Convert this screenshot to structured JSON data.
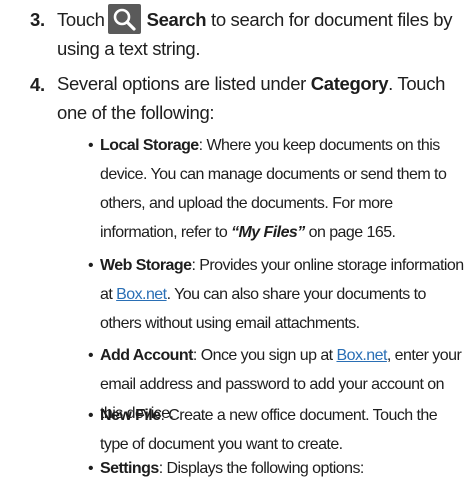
{
  "steps": [
    {
      "number": "3.",
      "icon": "search-icon",
      "bold": "Search",
      "text": " to search for document files by using a text string."
    },
    {
      "number": "4.",
      "pre": "Several options are listed under ",
      "bold": "Category",
      "post": ". Touch one of the following:"
    }
  ],
  "bullets": [
    {
      "term": "Local Storage",
      "text": ": Where you keep documents on this device. You can manage documents or send them to others, and upload the documents. For more information, refer to ",
      "ref": "“My Files”",
      "after": " on page 165."
    },
    {
      "term": "Web Storage",
      "text": ": Provides your online storage information at ",
      "link": "Box.net",
      "after": ". You can also share your documents to others without using email attachments."
    },
    {
      "term": "Add Account",
      "text": ": Once you sign up at ",
      "link": "Box.net",
      "after": ", enter your email address and password to add your account on this device."
    },
    {
      "term": "New File",
      "text": ": Create a new office document. Touch the type of document you want to create."
    },
    {
      "term": "Settings",
      "text": ": Displays the following options:"
    }
  ],
  "colors": {
    "text": "#1e1e1e",
    "link": "#2a6fb5",
    "icon_bg": "#5a5a5a"
  }
}
